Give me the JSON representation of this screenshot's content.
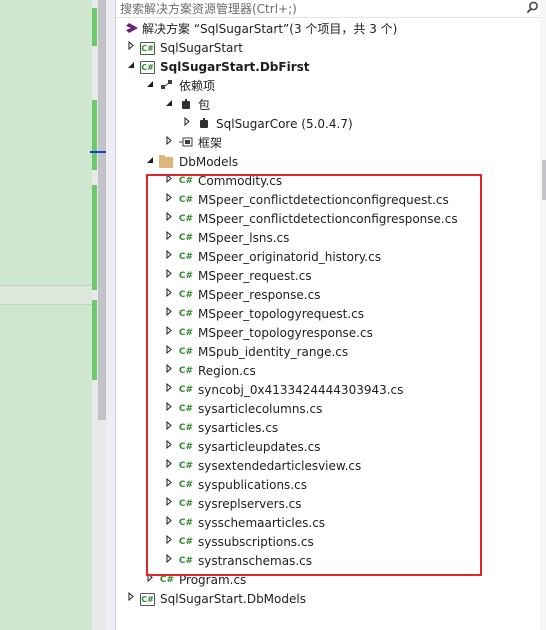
{
  "search": {
    "placeholder": "搜索解决方案资源管理器(Ctrl+;)"
  },
  "solution": {
    "label": "解决方案 “SqlSugarStart”(3 个项目，共 3 个)"
  },
  "tree": [
    {
      "label": "SqlSugarStart",
      "icon": "csharp-project-icon",
      "level": 1,
      "expander": "collapsed",
      "bold": false
    },
    {
      "label": "SqlSugarStart.DbFirst",
      "icon": "csharp-project-icon",
      "level": 1,
      "expander": "expanded",
      "bold": true
    },
    {
      "label": "依赖项",
      "icon": "dependencies-icon",
      "level": 2,
      "expander": "expanded",
      "bold": false
    },
    {
      "label": "包",
      "icon": "package-icon",
      "level": 3,
      "expander": "expanded",
      "bold": false
    },
    {
      "label": "SqlSugarCore (5.0.4.7)",
      "icon": "package-icon",
      "level": 4,
      "expander": "collapsed",
      "bold": false
    },
    {
      "label": "框架",
      "icon": "framework-icon",
      "level": 3,
      "expander": "collapsed",
      "bold": false
    },
    {
      "label": "DbModels",
      "icon": "folder-icon",
      "level": 2,
      "expander": "expanded",
      "bold": false
    },
    {
      "label": "Commodity.cs",
      "icon": "csharp-file-icon",
      "level": 3,
      "expander": "collapsed",
      "bold": false
    },
    {
      "label": "MSpeer_conflictdetectionconfigrequest.cs",
      "icon": "csharp-file-icon",
      "level": 3,
      "expander": "collapsed",
      "bold": false
    },
    {
      "label": "MSpeer_conflictdetectionconfigresponse.cs",
      "icon": "csharp-file-icon",
      "level": 3,
      "expander": "collapsed",
      "bold": false
    },
    {
      "label": "MSpeer_lsns.cs",
      "icon": "csharp-file-icon",
      "level": 3,
      "expander": "collapsed",
      "bold": false
    },
    {
      "label": "MSpeer_originatorid_history.cs",
      "icon": "csharp-file-icon",
      "level": 3,
      "expander": "collapsed",
      "bold": false
    },
    {
      "label": "MSpeer_request.cs",
      "icon": "csharp-file-icon",
      "level": 3,
      "expander": "collapsed",
      "bold": false
    },
    {
      "label": "MSpeer_response.cs",
      "icon": "csharp-file-icon",
      "level": 3,
      "expander": "collapsed",
      "bold": false
    },
    {
      "label": "MSpeer_topologyrequest.cs",
      "icon": "csharp-file-icon",
      "level": 3,
      "expander": "collapsed",
      "bold": false
    },
    {
      "label": "MSpeer_topologyresponse.cs",
      "icon": "csharp-file-icon",
      "level": 3,
      "expander": "collapsed",
      "bold": false
    },
    {
      "label": "MSpub_identity_range.cs",
      "icon": "csharp-file-icon",
      "level": 3,
      "expander": "collapsed",
      "bold": false
    },
    {
      "label": "Region.cs",
      "icon": "csharp-file-icon",
      "level": 3,
      "expander": "collapsed",
      "bold": false
    },
    {
      "label": "syncobj_0x4133424444303943.cs",
      "icon": "csharp-file-icon",
      "level": 3,
      "expander": "collapsed",
      "bold": false
    },
    {
      "label": "sysarticlecolumns.cs",
      "icon": "csharp-file-icon",
      "level": 3,
      "expander": "collapsed",
      "bold": false
    },
    {
      "label": "sysarticles.cs",
      "icon": "csharp-file-icon",
      "level": 3,
      "expander": "collapsed",
      "bold": false
    },
    {
      "label": "sysarticleupdates.cs",
      "icon": "csharp-file-icon",
      "level": 3,
      "expander": "collapsed",
      "bold": false
    },
    {
      "label": "sysextendedarticlesview.cs",
      "icon": "csharp-file-icon",
      "level": 3,
      "expander": "collapsed",
      "bold": false
    },
    {
      "label": "syspublications.cs",
      "icon": "csharp-file-icon",
      "level": 3,
      "expander": "collapsed",
      "bold": false
    },
    {
      "label": "sysreplservers.cs",
      "icon": "csharp-file-icon",
      "level": 3,
      "expander": "collapsed",
      "bold": false
    },
    {
      "label": "sysschemaarticles.cs",
      "icon": "csharp-file-icon",
      "level": 3,
      "expander": "collapsed",
      "bold": false
    },
    {
      "label": "syssubscriptions.cs",
      "icon": "csharp-file-icon",
      "level": 3,
      "expander": "collapsed",
      "bold": false
    },
    {
      "label": "systranschemas.cs",
      "icon": "csharp-file-icon",
      "level": 3,
      "expander": "collapsed",
      "bold": false
    },
    {
      "label": "Program.cs",
      "icon": "csharp-file-icon",
      "level": 2,
      "expander": "collapsed",
      "bold": false
    },
    {
      "label": "SqlSugarStart.DbModels",
      "icon": "csharp-project-icon",
      "level": 1,
      "expander": "collapsed",
      "bold": false
    }
  ],
  "colors": {
    "highlight_border": "#e0262f",
    "csharp": "#2f8a2f",
    "change_bar": "#6cc96c"
  }
}
